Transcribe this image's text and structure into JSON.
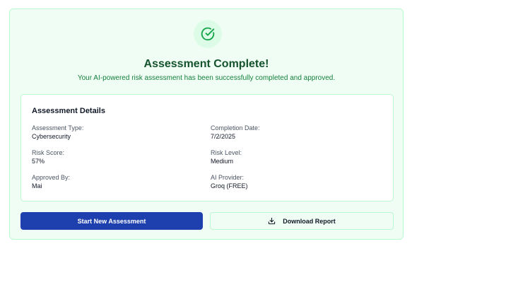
{
  "header": {
    "icon": "check-circle-icon",
    "title": "Assessment Complete!",
    "subtitle": "Your AI-powered risk assessment has been successfully completed and approved."
  },
  "details": {
    "title": "Assessment Details",
    "fields": [
      {
        "label": "Assessment Type:",
        "value": "Cybersecurity"
      },
      {
        "label": "Completion Date:",
        "value": "7/2/2025"
      },
      {
        "label": "Risk Score:",
        "value": "57%"
      },
      {
        "label": "Risk Level:",
        "value": "Medium"
      },
      {
        "label": "Approved By:",
        "value": "Mai"
      },
      {
        "label": "AI Provider:",
        "value": "Groq (FREE)"
      }
    ]
  },
  "actions": {
    "start_label": "Start New Assessment",
    "download_label": "Download Report",
    "download_icon": "download-icon"
  },
  "colors": {
    "success_bg": "#f0fdf4",
    "success_border": "#bbf7d0",
    "success_title": "#14532d",
    "success_text": "#15803d",
    "primary": "#1e40af"
  }
}
